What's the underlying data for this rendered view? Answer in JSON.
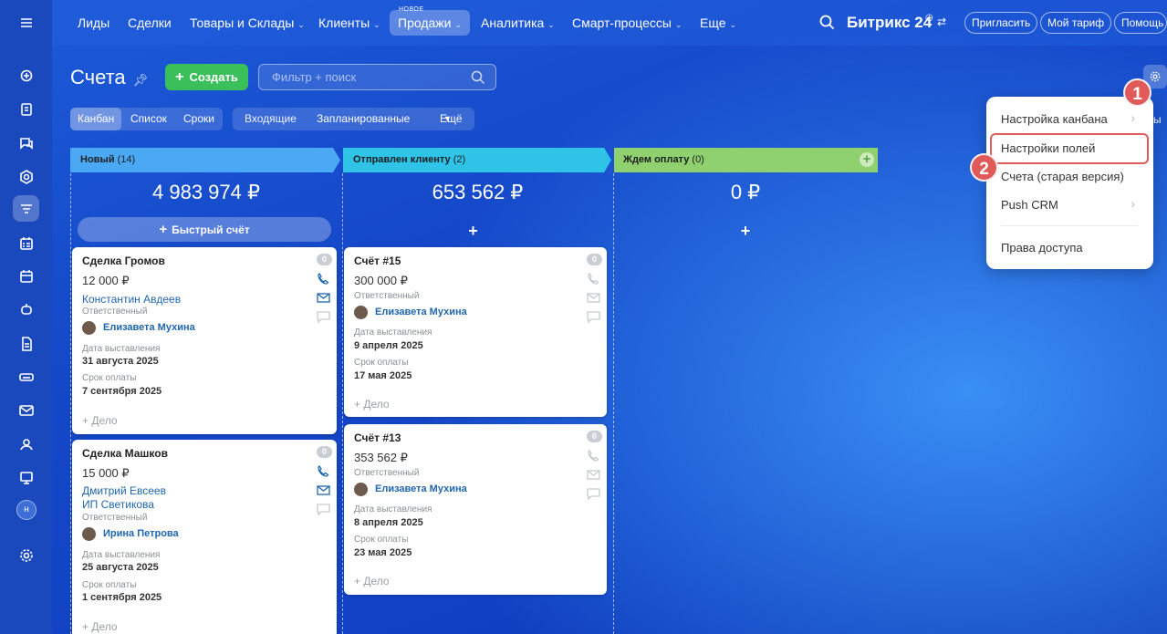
{
  "topnav": {
    "items": [
      "Лиды",
      "Сделки",
      "Товары и Склады",
      "Клиенты",
      "Продажи",
      "Аналитика",
      "Смарт-процессы",
      "Еще"
    ],
    "new_badge": "НОВОЕ",
    "brand": "Битрикс 24",
    "invite": "Пригласить",
    "tariff": "Мой тариф",
    "help": "Помощь"
  },
  "header": {
    "title": "Счета",
    "create_label": "Создать",
    "filter_placeholder": "Фильтр + поиск"
  },
  "views": {
    "kanban": "Канбан",
    "list": "Список",
    "terms": "Сроки"
  },
  "filters": {
    "incoming": "Входящие",
    "planned": "Запланированные",
    "more": "Ещё"
  },
  "columns": [
    {
      "name": "Новый",
      "count": "(14)",
      "sum": "4 983 974 ₽",
      "color": "#4aa8f5"
    },
    {
      "name": "Отправлен клиенту",
      "count": "(2)",
      "sum": "653 562 ₽",
      "color": "#2fc3e8"
    },
    {
      "name": "Ждем оплату",
      "count": "(0)",
      "sum": "0 ₽",
      "color": "#8fd16f"
    }
  ],
  "quick_invoice": "Быстрый счёт",
  "add_symbol": "+",
  "labels": {
    "responsible": "Ответственный",
    "issued": "Дата выставления",
    "due": "Срок оплаты",
    "task": "+ Дело"
  },
  "cards": [
    {
      "title": "Сделка Громов",
      "price": "12 000 ₽",
      "contact": "Константин Авдеев",
      "user": "Елизавета Мухина",
      "issued": "31 августа 2025",
      "due": "7 сентября 2025",
      "badge": "0"
    },
    {
      "title": "Сделка Машков",
      "price": "15 000 ₽",
      "contact": "Дмитрий Евсеев",
      "company": "ИП Светикова",
      "user": "Ирина Петрова",
      "issued": "25 августа 2025",
      "due": "1 сентября 2025",
      "badge": "0"
    },
    {
      "title": "Счёт #15",
      "price": "300 000 ₽",
      "user": "Елизавета Мухина",
      "issued": "9 апреля 2025",
      "due": "17 мая 2025",
      "badge": "0"
    },
    {
      "title": "Счёт #13",
      "price": "353 562 ₽",
      "user": "Елизавета Мухина",
      "issued": "8 апреля 2025",
      "due": "23 мая 2025",
      "badge": "0"
    }
  ],
  "menu": {
    "items": [
      "Настройка канбана",
      "Настройки полей",
      "Счета (старая версия)",
      "Push CRM",
      "Права доступа"
    ]
  },
  "markers": [
    "1",
    "2"
  ],
  "sidebar": {
    "avatar_letter": "н"
  },
  "partial_text": "ы"
}
